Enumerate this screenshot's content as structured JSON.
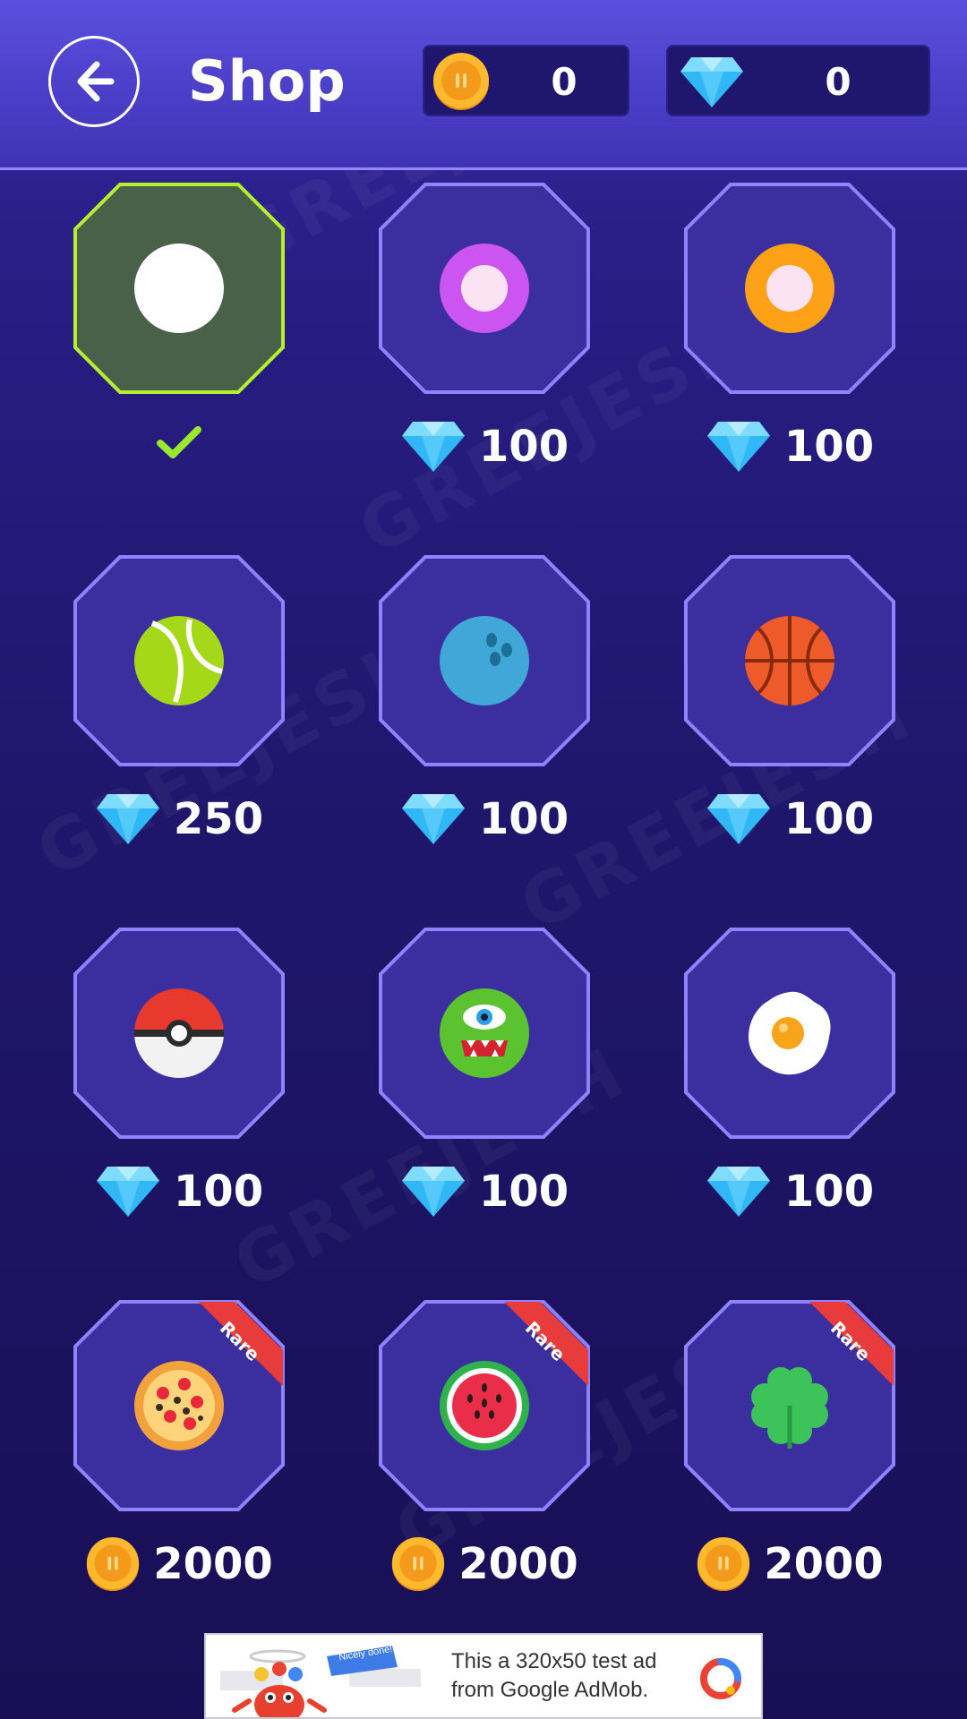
{
  "header": {
    "title": "Shop",
    "back_icon": "arrow-left-icon",
    "coins": "0",
    "gems": "0"
  },
  "colors": {
    "header_bg": "#4b3fc8",
    "tile_border": "#8f82ff",
    "selected_border": "#b7ee2e",
    "selected_fill": "#4a6149",
    "checkmark": "#9be62e",
    "rare_ribbon": "#e83b3b"
  },
  "shop": {
    "items": [
      {
        "ball": "white-ball",
        "selected": true,
        "price": null,
        "currency": null
      },
      {
        "ball": "purple-ring-ball",
        "price": "100",
        "currency": "gem"
      },
      {
        "ball": "orange-ring-ball",
        "price": "100",
        "currency": "gem"
      },
      {
        "ball": "tennis-ball",
        "price": "250",
        "currency": "gem"
      },
      {
        "ball": "bowling-ball",
        "price": "100",
        "currency": "gem"
      },
      {
        "ball": "basketball",
        "price": "100",
        "currency": "gem"
      },
      {
        "ball": "pokeball",
        "price": "100",
        "currency": "gem"
      },
      {
        "ball": "monster-ball",
        "price": "100",
        "currency": "gem"
      },
      {
        "ball": "fried-egg",
        "price": "100",
        "currency": "gem"
      },
      {
        "ball": "pizza",
        "price": "2000",
        "currency": "coin",
        "badge": "Rare"
      },
      {
        "ball": "watermelon",
        "price": "2000",
        "currency": "coin",
        "badge": "Rare"
      },
      {
        "ball": "clover",
        "price": "2000",
        "currency": "coin",
        "badge": "Rare"
      }
    ]
  },
  "watermark": "GREEJESH",
  "ad": {
    "line1": "This a 320x50 test ad",
    "line2": "from Google AdMob.",
    "nice_banner": "Nicely done!"
  }
}
